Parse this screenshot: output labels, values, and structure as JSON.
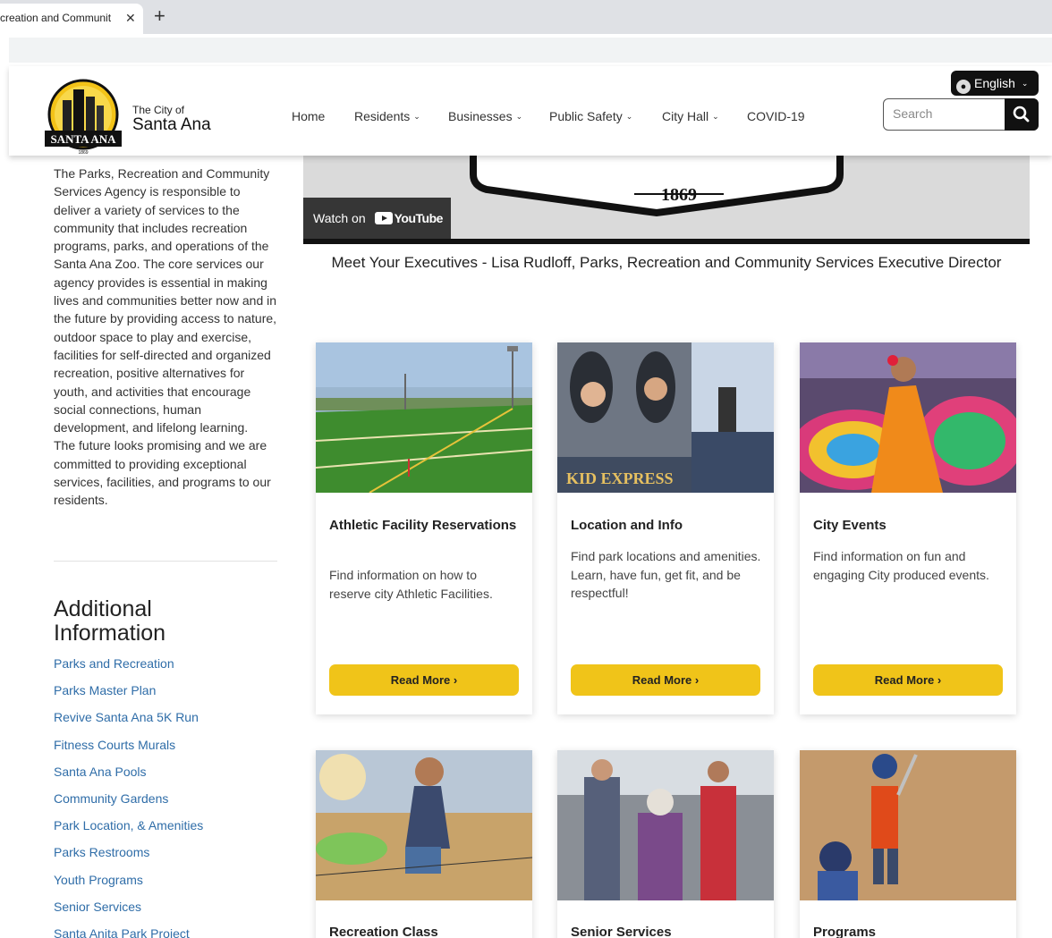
{
  "browser": {
    "tab_title": "creation and Communit",
    "tab_close": "✕",
    "new_tab": "+"
  },
  "header": {
    "logo_text": "SANTA ANA",
    "logo_year": "1869",
    "city_of": "The City of",
    "city_name": "Santa Ana",
    "nav": [
      {
        "label": "Home",
        "chevron": ""
      },
      {
        "label": "Residents",
        "chevron": "⌄"
      },
      {
        "label": "Businesses",
        "chevron": "⌄"
      },
      {
        "label": "Public Safety",
        "chevron": "⌄"
      },
      {
        "label": "City Hall",
        "chevron": "⌄"
      },
      {
        "label": "COVID-19",
        "chevron": ""
      }
    ],
    "language": "English",
    "language_chevron": "⌄",
    "search_placeholder": "Search"
  },
  "intro": {
    "paragraph1": "The Parks, Recreation and Community Services Agency is responsible to deliver a variety of services to the community that includes recreation programs, parks, and operations of the Santa Ana Zoo. The core services our agency provides is essential in making lives and communities better now and in the future by providing access to nature, outdoor space to play and exercise, facilities for self-directed and organized recreation, positive alternatives for youth, and activities that encourage social connections, human development, and lifelong learning.",
    "paragraph2": "The future looks promising and we are committed to providing exceptional services, facilities, and programs to our residents."
  },
  "additional": {
    "heading": "Additional Information",
    "links": [
      "Parks and Recreation",
      "Parks Master Plan",
      "Revive Santa Ana 5K Run",
      "Fitness Courts Murals",
      "Santa Ana Pools",
      "Community Gardens",
      "Park Location, & Amenities",
      "Parks Restrooms",
      "Youth Programs",
      "Senior Services",
      "Santa Anita Park Project"
    ]
  },
  "video": {
    "seal_year": "1869",
    "watch_on": "Watch on",
    "youtube": "YouTube",
    "caption": "Meet Your Executives - Lisa Rudloff, Parks, Recreation and Community Services Executive Director"
  },
  "cards": [
    {
      "title": "Athletic Facility Reservations",
      "desc": "Find information on how to reserve city Athletic Facilities.",
      "button": "Read More ›"
    },
    {
      "title": "Location and Info",
      "desc": "Find park locations and amenities. Learn, have fun, get fit, and be respectful!",
      "button": "Read More ›",
      "img_text": "KID EXPRESS"
    },
    {
      "title": "City Events",
      "desc": "Find information on fun and engaging City produced events.",
      "button": "Read More ›"
    }
  ],
  "cards_row2": [
    {
      "title": "Recreation Class"
    },
    {
      "title": "Senior Services"
    },
    {
      "title": "Programs"
    }
  ],
  "colors": {
    "accent_yellow": "#f0c419",
    "link_blue": "#2f6da8",
    "dark": "#111111"
  }
}
